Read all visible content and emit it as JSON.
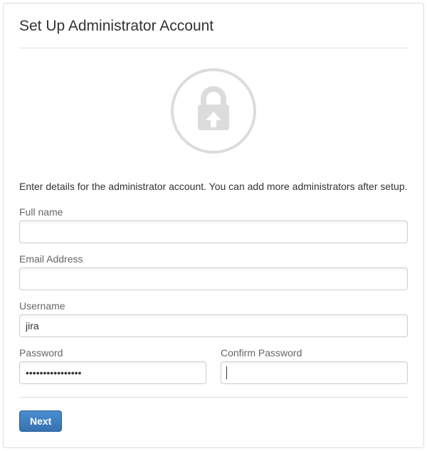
{
  "header": {
    "title": "Set Up Administrator Account"
  },
  "hero": {
    "icon_name": "lock-upload-icon"
  },
  "instructions": "Enter details for the administrator account. You can add more administrators after setup.",
  "form": {
    "fullname": {
      "label": "Full name",
      "value": ""
    },
    "email": {
      "label": "Email Address",
      "value": ""
    },
    "username": {
      "label": "Username",
      "value": "jira"
    },
    "password": {
      "label": "Password",
      "value": "••••••••••••••••"
    },
    "confirm_password": {
      "label": "Confirm Password",
      "value": ""
    }
  },
  "actions": {
    "next_label": "Next"
  }
}
